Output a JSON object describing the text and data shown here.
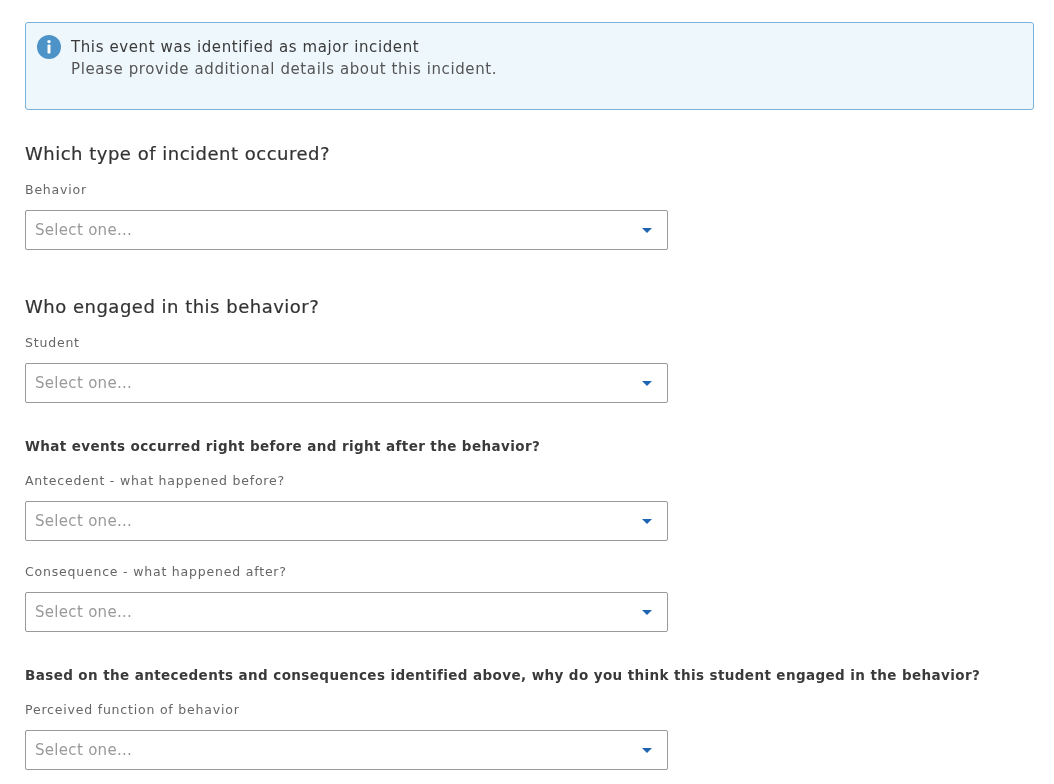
{
  "alert": {
    "kind": "info",
    "title": "This event was identified as major incident",
    "message": "Please provide additional details about this incident."
  },
  "sections": [
    {
      "kind": "heading",
      "title": "Which type of incident occured?",
      "fields": [
        {
          "label": "Behavior",
          "placeholder": "Select one..."
        }
      ]
    },
    {
      "kind": "heading",
      "title": "Who engaged in this behavior?",
      "fields": [
        {
          "label": "Student",
          "placeholder": "Select one..."
        }
      ]
    },
    {
      "kind": "question",
      "title": "What events occurred right before and right after the behavior?",
      "fields": [
        {
          "label": "Antecedent - what happened before?",
          "placeholder": "Select one..."
        },
        {
          "label": "Consequence - what happened after?",
          "placeholder": "Select one..."
        }
      ]
    },
    {
      "kind": "question",
      "title": "Based on the antecedents and consequences identified above, why do you think this student engaged in the behavior?",
      "fields": [
        {
          "label": "Perceived function of behavior",
          "placeholder": "Select one..."
        }
      ]
    }
  ]
}
